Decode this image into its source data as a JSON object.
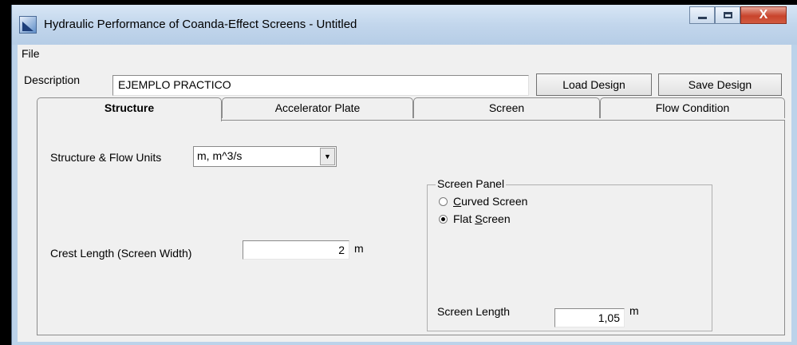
{
  "window": {
    "title": "Hydraulic Performance of Coanda-Effect Screens - Untitled",
    "controls": {
      "minimize": "—",
      "maximize": "□",
      "close": "X"
    }
  },
  "menu": {
    "file": "File"
  },
  "description": {
    "label": "Description",
    "value": "EJEMPLO PRACTICO"
  },
  "buttons": {
    "load": "Load Design",
    "save": "Save Design"
  },
  "tabs": [
    {
      "label": "Structure",
      "active": true
    },
    {
      "label": "Accelerator Plate",
      "active": false
    },
    {
      "label": "Screen",
      "active": false
    },
    {
      "label": "Flow Condition",
      "active": false
    }
  ],
  "structure": {
    "units_label": "Structure & Flow Units",
    "units_value": "m, m^3/s",
    "crest_label": "Crest Length (Screen Width)",
    "crest_value": "2",
    "crest_unit": "m"
  },
  "screen_panel": {
    "title": "Screen Panel",
    "curved_prefix": "",
    "curved_accel": "C",
    "curved_rest": "urved Screen",
    "flat_prefix": "Flat ",
    "flat_accel": "S",
    "flat_rest": "creen",
    "selected": "flat",
    "length_label": "Screen Length",
    "length_value": "1,05",
    "length_unit": "m"
  }
}
